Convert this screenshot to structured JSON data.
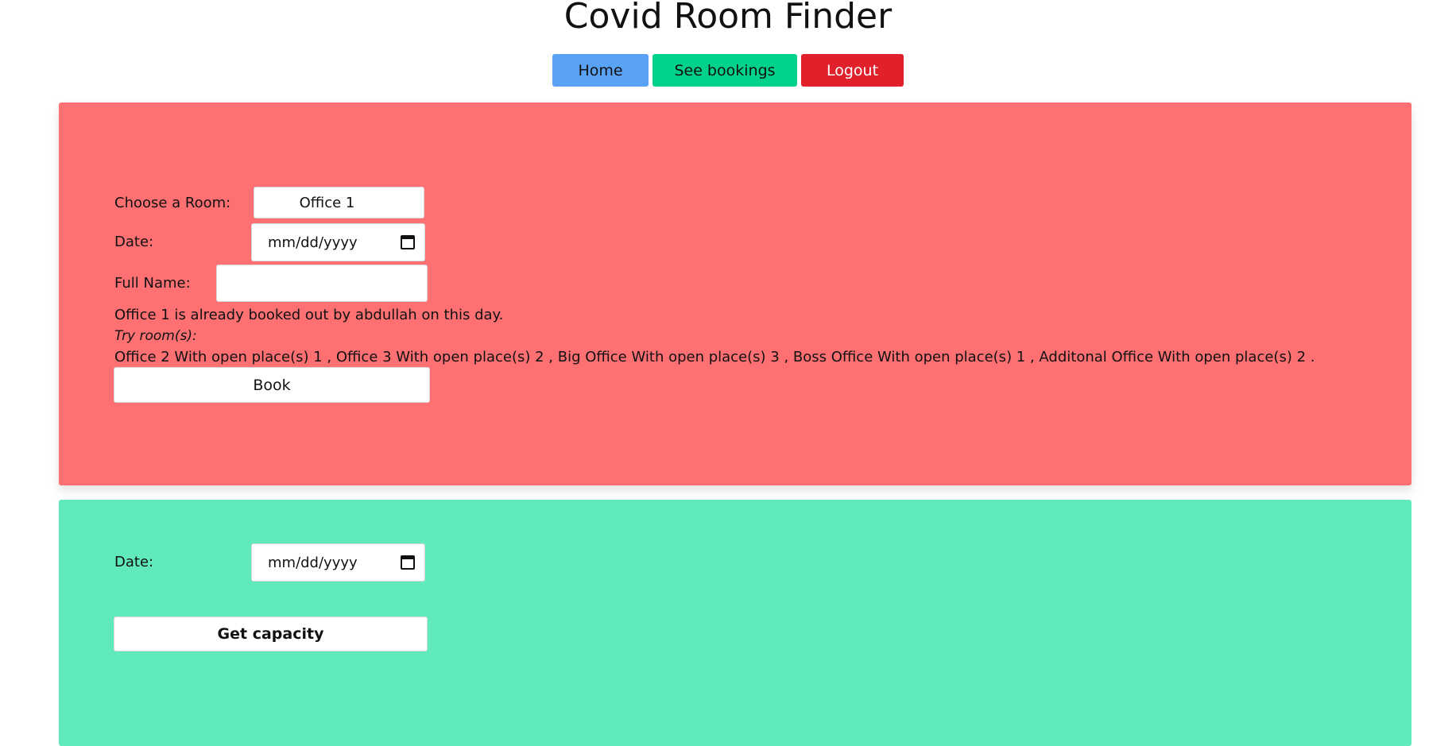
{
  "header": {
    "title": "Covid Room Finder"
  },
  "nav": {
    "home_label": "Home",
    "bookings_label": "See bookings",
    "logout_label": "Logout"
  },
  "booking": {
    "room_label": "Choose a Room:",
    "room_value": "Office 1",
    "date_label": "Date:",
    "date_placeholder": "mm/dd/yyyy",
    "name_label": "Full Name:",
    "name_value": "",
    "error_message": "Office 1 is already booked out by abdullah on this day.",
    "try_label": "Try room(s):",
    "suggestions": "Office 2 With open place(s) 1 , Office 3 With open place(s) 2 , Big Office With open place(s) 3 , Boss Office With open place(s) 1 , Additonal Office With open place(s) 2 .",
    "book_label": "Book"
  },
  "capacity": {
    "date_label": "Date:",
    "date_placeholder": "mm/dd/yyyy",
    "button_label": "Get capacity"
  },
  "colors": {
    "home": "#5aa2f5",
    "bookings": "#00d28d",
    "logout": "#e0202b",
    "booking_panel": "#ff7073",
    "capacity_panel": "#60e9b9"
  },
  "icons": {
    "date_picker": "calendar-icon"
  }
}
